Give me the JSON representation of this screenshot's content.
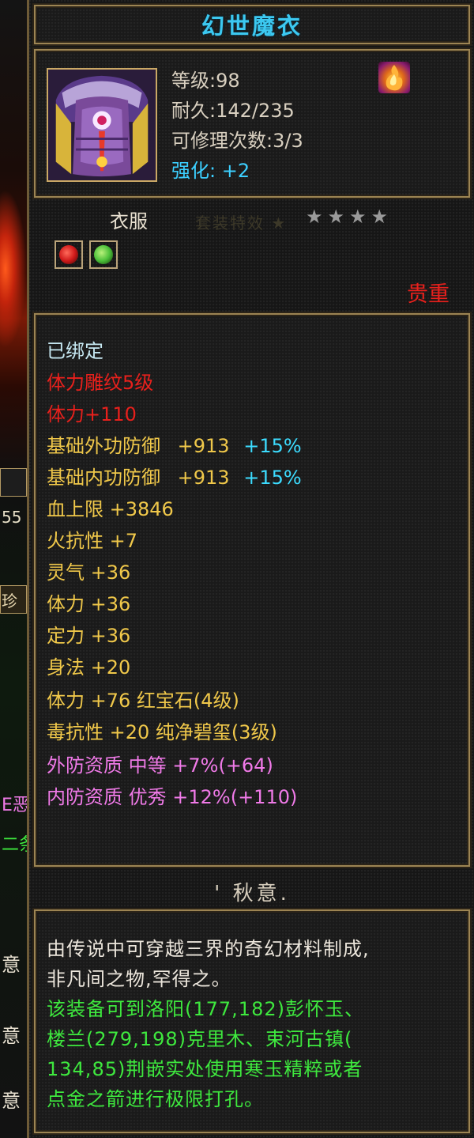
{
  "left_strip": {
    "fragments": [
      "55",
      "珍",
      "E恶",
      "二条",
      "意",
      "意",
      "意"
    ]
  },
  "item": {
    "name": "幻世魔衣",
    "level": "等级:98",
    "durability": "耐久:142/235",
    "repair_count": "可修理次数:3/3",
    "enhance": "强化: +2",
    "type": "衣服",
    "faded_text": "套装特效 ★",
    "stars": [
      "★",
      "★",
      "★",
      "★"
    ],
    "rarity": "贵重",
    "colors": {
      "title": "#3cc8f0",
      "rarity": "#e8201c",
      "enhance": "#3ccfff"
    }
  },
  "gems": [
    {
      "name": "红宝石",
      "icon": "red-gem-icon",
      "color": "#d01a1a"
    },
    {
      "name": "纯净碧玺",
      "icon": "green-gem-icon",
      "color": "#4cc03a"
    }
  ],
  "attributes": {
    "bound": "已绑定",
    "carving": "体力雕纹5级",
    "stamina_bonus": "体力+110",
    "base_ext_def": {
      "label": "基础外功防御",
      "value": "+913",
      "pct": "+15%"
    },
    "base_int_def": {
      "label": "基础内功防御",
      "value": "+913",
      "pct": "+15%"
    },
    "hp_max": "血上限  +3846",
    "fire_res": "火抗性  +7",
    "spirit": "灵气  +36",
    "stamina": "体力  +36",
    "focus": "定力  +36",
    "agility": "身法  +20",
    "gem1": "体力  +76  红宝石(4级)",
    "gem2": "毒抗性  +20  纯净碧玺(3级)",
    "ext_quality": "外防资质    中等  +7%(+64)",
    "int_quality": "内防资质    优秀  +12%(+110)"
  },
  "owner": "' 秋意.",
  "description": {
    "line1": "由传说中可穿越三界的奇幻材料制成,",
    "line2": "非凡间之物,罕得之。",
    "line3": "该装备可到洛阳(177,182)彭怀玉、",
    "line4": "楼兰(279,198)克里木、束河古镇(",
    "line5": "134,85)荆嵌实处使用寒玉精粹或者",
    "line6": "点金之箭进行极限打孔。"
  }
}
